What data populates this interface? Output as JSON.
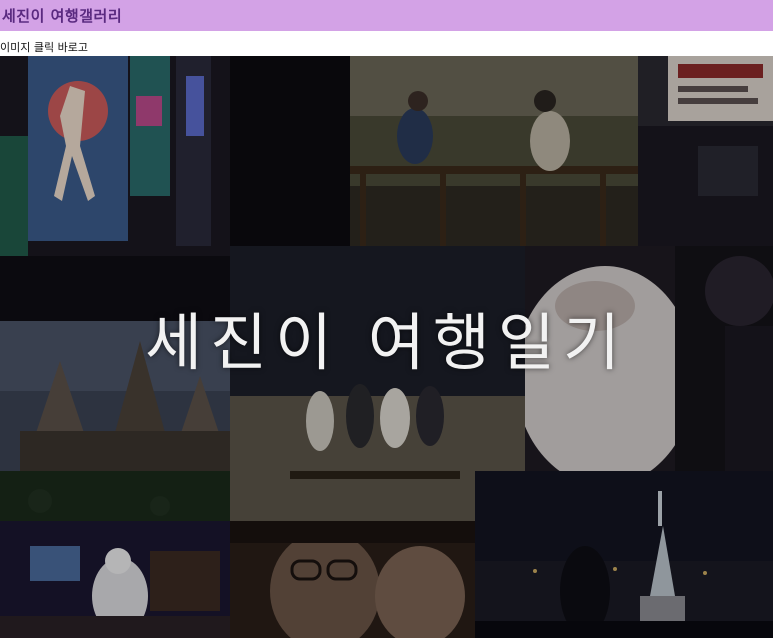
{
  "header": {
    "title": "세진이 여행갤러리"
  },
  "subline": {
    "text": "이미지 클릭 바로고"
  },
  "collage": {
    "overlay_title": "세진이 여행일기",
    "colors": {
      "header_bg": "#d3a2e6",
      "header_text": "#5a2a80",
      "overlay_text": "#f2f2f2"
    },
    "photos": [
      "osaka-glico-sign-photo",
      "wooden-fence-park-photo",
      "japanese-signboard-photo",
      "hogwarts-castle-photo",
      "group-on-sand-photo",
      "friend-closeup-photo",
      "night-plaza-photo",
      "selfie-with-glasses-photo",
      "statue-of-liberty-night-photo"
    ]
  }
}
